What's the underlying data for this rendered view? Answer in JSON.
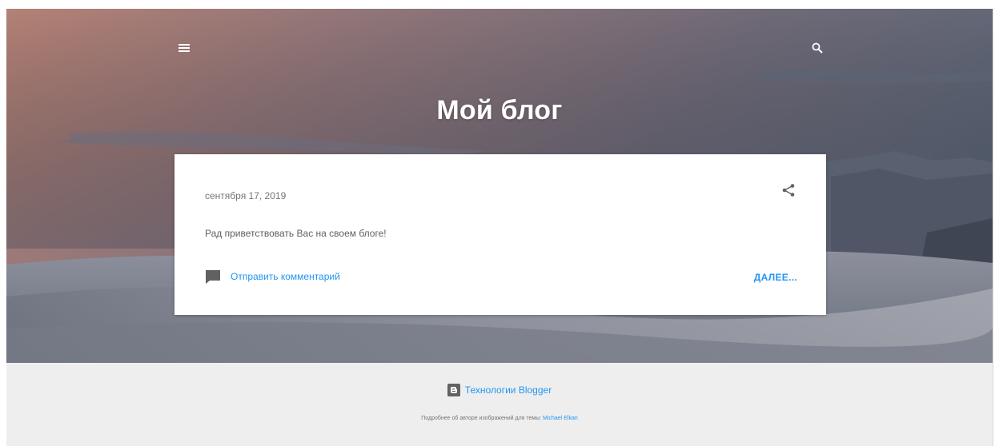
{
  "header": {
    "title": "Мой блог",
    "menu_icon": "hamburger-menu-icon",
    "search_icon": "search-icon"
  },
  "post": {
    "date": "сентября 17, 2019",
    "body": "Рад приветствовать Вас на своем блоге!",
    "comment_label": "Отправить комментарий",
    "more_label": "ДАЛЕЕ...",
    "share_icon": "share-icon",
    "comment_icon": "comment-icon"
  },
  "footer": {
    "powered_by": "Технологии Blogger",
    "credits_prefix": "Подробнее об авторе изображений для темы:",
    "credits_author": "Michael Elkan",
    "blogger_icon": "blogger-logo-icon"
  },
  "colors": {
    "accent": "#2196f3",
    "footer_bg": "#eeeeee",
    "text_muted": "#757575"
  }
}
